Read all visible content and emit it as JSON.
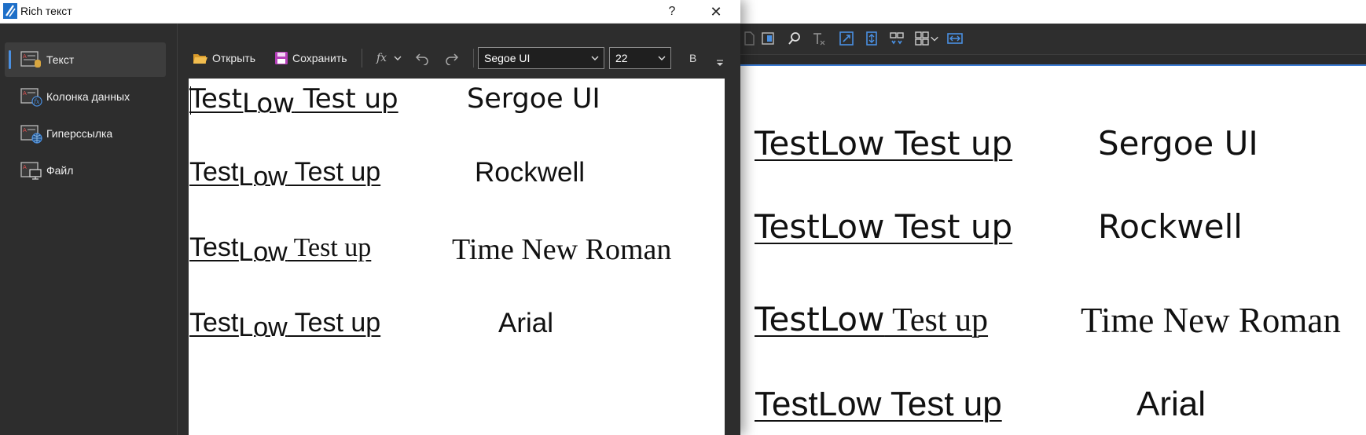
{
  "dialog": {
    "title": "Rich текст",
    "help_label": "?",
    "close_label": "✕"
  },
  "sidebar": {
    "items": [
      {
        "label": "Текст",
        "icon": "text-field-icon",
        "active": true
      },
      {
        "label": "Колонка данных",
        "icon": "data-column-fx-icon",
        "active": false
      },
      {
        "label": "Гиперссылка",
        "icon": "hyperlink-globe-icon",
        "active": false
      },
      {
        "label": "Файл",
        "icon": "file-monitor-icon",
        "active": false
      }
    ]
  },
  "toolbar": {
    "open_label": "Открыть",
    "save_label": "Сохранить",
    "fx_label": "fx",
    "font_family": "Segoe UI",
    "font_size": "22",
    "bold_label": "B"
  },
  "editor": {
    "rows": [
      {
        "part1": "Test",
        "part2": "Low",
        "part3": " Test up",
        "font_name": "Sergoe UI"
      },
      {
        "part1": "Test",
        "part2": "Low",
        "part3": " Test up",
        "font_name": "Rockwell"
      },
      {
        "part1": "Test",
        "part2": "Low",
        "part3": " Test up",
        "font_name": "Time New Roman"
      },
      {
        "part1": "Test",
        "part2": "Low",
        "part3": " Test up",
        "font_name": "Arial"
      }
    ]
  },
  "preview": {
    "rows": [
      {
        "sample": "TestLow Test up",
        "font_name": "Sergoe UI"
      },
      {
        "sample": "TestLow Test up",
        "font_name": "Rockwell"
      },
      {
        "sample": "TestLow Test up",
        "font_name": "Time New Roman"
      },
      {
        "sample": "TestLow Test up",
        "font_name": "Arial"
      }
    ]
  },
  "colors": {
    "accent": "#4a90e2",
    "dark_bg": "#2d2d2d",
    "paper": "#ffffff"
  }
}
